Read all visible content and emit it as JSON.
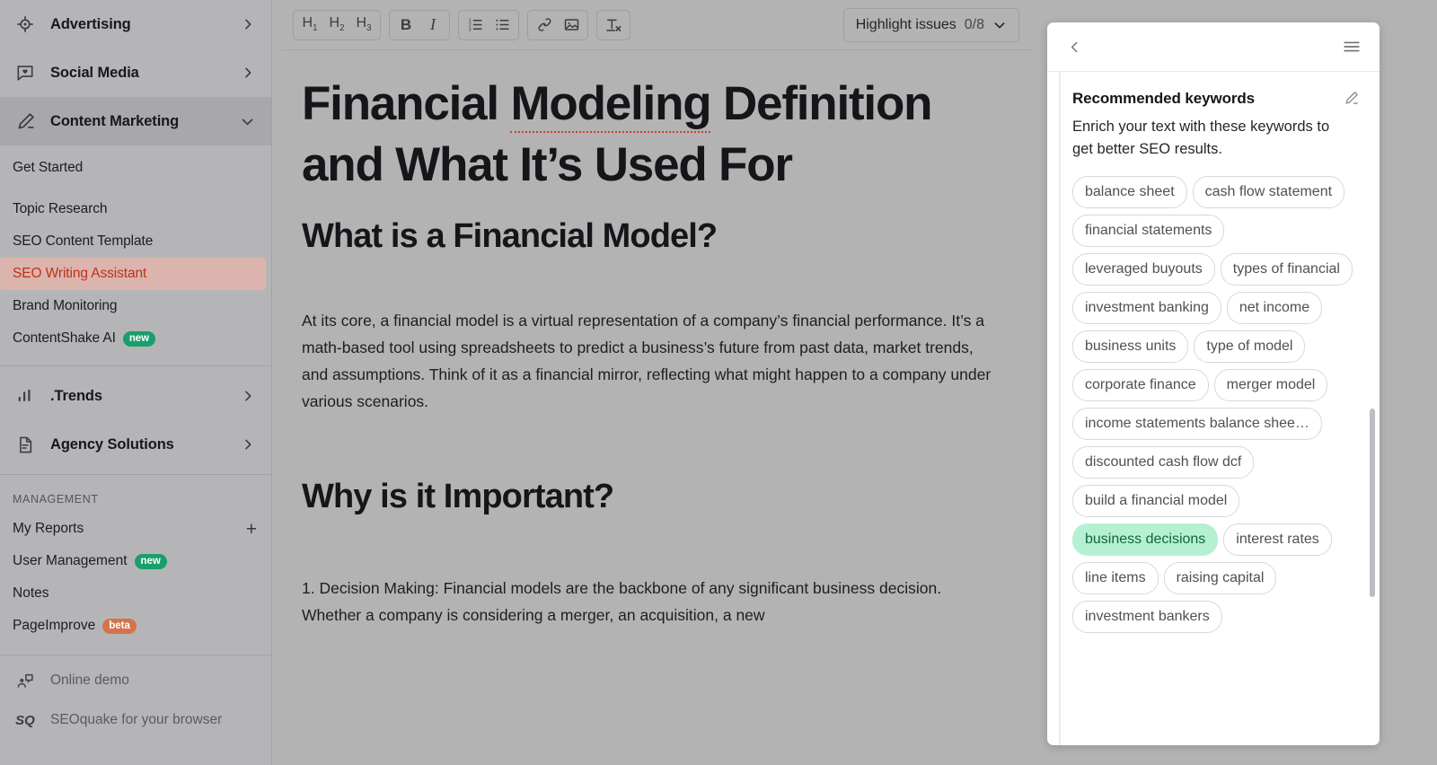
{
  "sidebar": {
    "nav": [
      {
        "label": "Advertising",
        "icon": "target-icon",
        "caret": "chevron-right"
      },
      {
        "label": "Social Media",
        "icon": "chat-heart-icon",
        "caret": "chevron-right"
      },
      {
        "label": "Content Marketing",
        "icon": "pencil-icon",
        "caret": "chevron-down",
        "active": true
      }
    ],
    "content_marketing_items": [
      {
        "label": "Get Started"
      },
      {
        "label": "Topic Research"
      },
      {
        "label": "SEO Content Template"
      },
      {
        "label": "SEO Writing Assistant",
        "selected": true
      },
      {
        "label": "Brand Monitoring"
      },
      {
        "label": "ContentShake AI",
        "badge": "new",
        "badge_color": "green"
      }
    ],
    "nav2": [
      {
        "label": ".Trends",
        "icon": "bar-chart-icon",
        "caret": "chevron-right"
      },
      {
        "label": "Agency Solutions",
        "icon": "document-icon",
        "caret": "chevron-right"
      }
    ],
    "management_title": "MANAGEMENT",
    "management_items": [
      {
        "label": "My Reports",
        "action": "+"
      },
      {
        "label": "User Management",
        "badge": "new",
        "badge_color": "green"
      },
      {
        "label": "Notes"
      },
      {
        "label": "PageImprove",
        "badge": "beta",
        "badge_color": "orange"
      }
    ],
    "footer_items": [
      {
        "label": "Online demo",
        "icon": "presenter-icon"
      },
      {
        "label": "SEOquake for your browser",
        "icon": "seoquake-logo",
        "logo_text": "SQ"
      }
    ]
  },
  "toolbar": {
    "heading_buttons": [
      {
        "label": "H",
        "sub": "1",
        "name": "heading-1-button"
      },
      {
        "label": "H",
        "sub": "2",
        "name": "heading-2-button"
      },
      {
        "label": "H",
        "sub": "3",
        "name": "heading-3-button"
      }
    ],
    "bold_label": "B",
    "italic_label": "I",
    "highlight_issues_label": "Highlight issues",
    "highlight_issues_count": "0/8"
  },
  "document": {
    "title_part1": "Financial ",
    "title_misspelled": "Modeling",
    "title_part2": " Definition and What It’s Used For",
    "heading_1": "What is a Financial Model?",
    "paragraph_1": "At its core, a financial model is a virtual representation of a company’s financial performance. It’s a math-based tool using spreadsheets to predict a business’s future from past data, market trends, and assumptions. Think of it as a financial mirror, reflecting what might happen to a company under various scenarios.",
    "heading_2": "Why is it Important?",
    "paragraph_2": "1. Decision Making: Financial models are the backbone of any significant business decision. Whether a company is considering a merger, an acquisition, a new"
  },
  "panel": {
    "title": "Recommended keywords",
    "description": "Enrich your text with these keywords to get better SEO results.",
    "keywords": [
      {
        "text": "balance sheet",
        "used": false
      },
      {
        "text": "cash flow statement",
        "used": false
      },
      {
        "text": "financial statements",
        "used": false
      },
      {
        "text": "leveraged buyouts",
        "used": false
      },
      {
        "text": "types of financial",
        "used": false
      },
      {
        "text": "investment banking",
        "used": false
      },
      {
        "text": "net income",
        "used": false
      },
      {
        "text": "business units",
        "used": false
      },
      {
        "text": "type of model",
        "used": false
      },
      {
        "text": "corporate finance",
        "used": false
      },
      {
        "text": "merger model",
        "used": false
      },
      {
        "text": "income statements balance shee…",
        "used": false,
        "truncated": true
      },
      {
        "text": "discounted cash flow dcf",
        "used": false
      },
      {
        "text": "build a financial model",
        "used": false
      },
      {
        "text": "business decisions",
        "used": true
      },
      {
        "text": "interest rates",
        "used": false
      },
      {
        "text": "line items",
        "used": false
      },
      {
        "text": "raising capital",
        "used": false
      },
      {
        "text": "investment bankers",
        "used": false
      }
    ]
  },
  "colors": {
    "selected_item_bg": "#dbb5ad",
    "selected_item_text": "#c0301a",
    "badge_green": "#1a9e6b",
    "badge_orange": "#d4744a",
    "keyword_used_bg": "#b6f0d2",
    "keyword_used_text": "#10663f",
    "panel_bg": "#ffffff",
    "backdrop": "#b3b3b3"
  }
}
